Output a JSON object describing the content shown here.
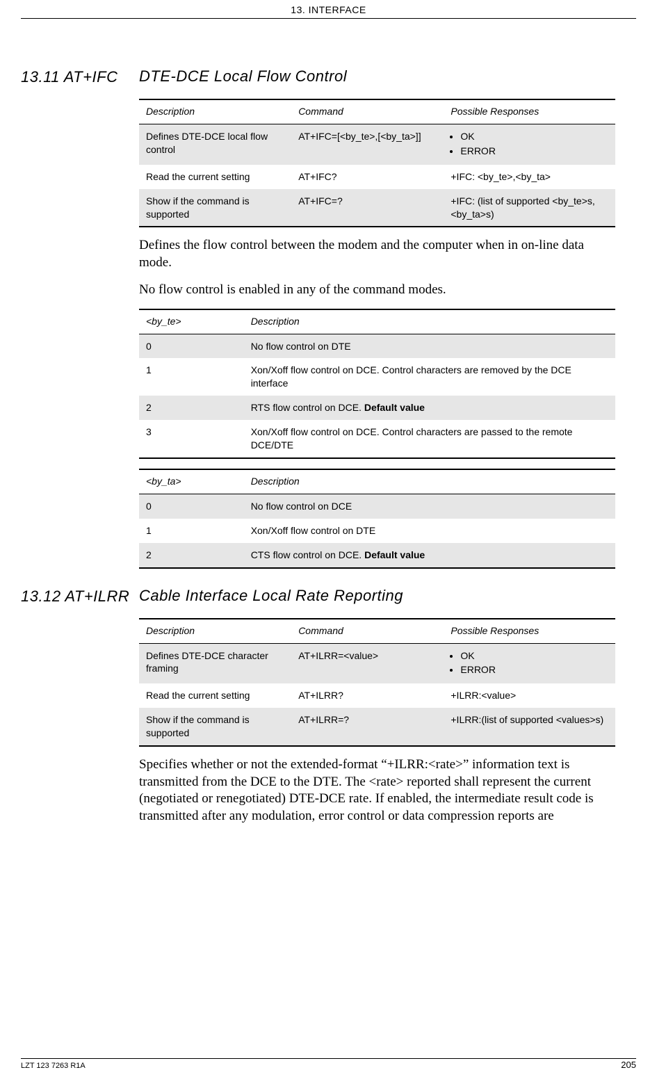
{
  "runhead": "13. INTERFACE",
  "sections": [
    {
      "num": "13.11 AT+IFC",
      "title": "DTE-DCE Local Flow Control",
      "cmd_table": {
        "headers": [
          "Description",
          "Command",
          "Possible Responses"
        ],
        "rows": [
          {
            "shade": true,
            "desc": "Defines DTE-DCE local flow control",
            "cmd": "AT+IFC=[<by_te>,[<by_ta>]]",
            "resp_list": [
              "OK",
              "ERROR"
            ]
          },
          {
            "shade": false,
            "desc": "Read the current setting",
            "cmd": "AT+IFC?",
            "resp": "+IFC: <by_te>,<by_ta>"
          },
          {
            "shade": true,
            "desc": "Show if the command is supported",
            "cmd": "AT+IFC=?",
            "resp": "+IFC: (list of supported <by_te>s,<by_ta>s)"
          }
        ]
      },
      "paras": [
        "Defines the flow control between the modem and the computer when in on-line data mode.",
        "No flow control is enabled in any of the command modes."
      ],
      "param_tables": [
        {
          "headers": [
            "<by_te>",
            "Description"
          ],
          "rows": [
            {
              "shade": true,
              "c0": "0",
              "c1": "No flow control on DTE"
            },
            {
              "shade": false,
              "c0": "1",
              "c1": "Xon/Xoff flow control on DCE. Control characters are removed by the DCE interface"
            },
            {
              "shade": true,
              "c0": "2",
              "c1_pre": "RTS flow control on DCE. ",
              "c1_bold": "Default value"
            },
            {
              "shade": false,
              "c0": "3",
              "c1": "Xon/Xoff flow control on DCE. Control characters are passed to the remote DCE/DTE"
            }
          ]
        },
        {
          "headers": [
            "<by_ta>",
            "Description"
          ],
          "rows": [
            {
              "shade": true,
              "c0": "0",
              "c1": "No flow control on DCE"
            },
            {
              "shade": false,
              "c0": "1",
              "c1": "Xon/Xoff flow control on DTE"
            },
            {
              "shade": true,
              "c0": "2",
              "c1_pre": "CTS flow control on DCE. ",
              "c1_bold": "Default value"
            }
          ]
        }
      ]
    },
    {
      "num": "13.12 AT+ILRR",
      "title": "Cable Interface Local Rate Reporting",
      "cmd_table": {
        "headers": [
          "Description",
          "Command",
          "Possible Responses"
        ],
        "rows": [
          {
            "shade": true,
            "desc": "Defines DTE-DCE character framing",
            "cmd": "AT+ILRR=<value>",
            "resp_list": [
              "OK",
              "ERROR"
            ]
          },
          {
            "shade": false,
            "desc": "Read the current setting",
            "cmd": "AT+ILRR?",
            "resp": "+ILRR:<value>"
          },
          {
            "shade": true,
            "desc": "Show if the command is supported",
            "cmd": "AT+ILRR=?",
            "resp": "+ILRR:(list of supported <values>s)"
          }
        ]
      },
      "paras2": [
        "Specifies whether or not the extended-format “+ILRR:<rate>” information text is transmitted from the DCE to the DTE. The <rate> reported shall represent the current (negotiated or renegotiated) DTE-DCE rate. If enabled, the intermediate result code is transmitted after any modulation, error control or data compression reports are"
      ]
    }
  ],
  "footer": {
    "left": "LZT 123 7263 R1A",
    "page": "205"
  }
}
